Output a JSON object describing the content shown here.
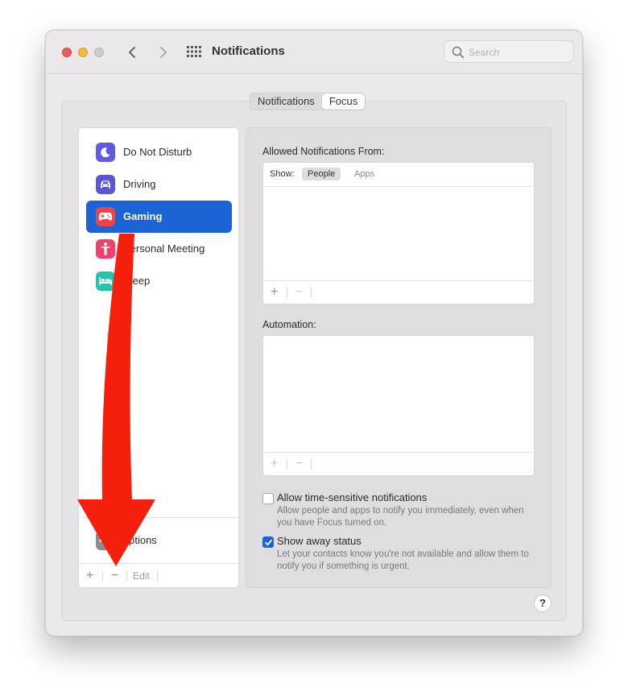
{
  "window": {
    "title": "Notifications",
    "search_placeholder": "Search"
  },
  "tabs": [
    {
      "label": "Notifications",
      "selected": false
    },
    {
      "label": "Focus",
      "selected": true
    }
  ],
  "sidebar": {
    "items": [
      {
        "label": "Do Not Disturb",
        "icon": "moon-icon",
        "color": "#5e5ce6",
        "selected": false
      },
      {
        "label": "Driving",
        "icon": "car-icon",
        "color": "#5a56d6",
        "selected": false
      },
      {
        "label": "Gaming",
        "icon": "gamepad-icon",
        "color": "#f04349",
        "selected": true
      },
      {
        "label": "Personal Meeting",
        "icon": "person-icon",
        "color": "#ef3f6c",
        "selected": false
      },
      {
        "label": "Sleep",
        "icon": "bed-icon",
        "color": "#25c3b1",
        "selected": false
      }
    ],
    "options_label": "Options",
    "footer": {
      "add": "+",
      "remove": "−",
      "edit": "Edit"
    }
  },
  "main": {
    "allowed_label": "Allowed Notifications From:",
    "show_label": "Show:",
    "show_options": [
      "People",
      "Apps"
    ],
    "show_selected": "People",
    "automation_label": "Automation:",
    "list_footer": {
      "add": "+",
      "remove": "−"
    },
    "time_sensitive": {
      "title": "Allow time-sensitive notifications",
      "description": "Allow people and apps to notify you immediately, even when you have Focus turned on.",
      "checked": false
    },
    "away_status": {
      "title": "Show away status",
      "description": "Let your contacts know you're not available and allow them to notify you if something is urgent.",
      "checked": true
    }
  },
  "help_label": "?",
  "colors": {
    "accent": "#1a64d6",
    "annotation_arrow": "#f5200b"
  }
}
